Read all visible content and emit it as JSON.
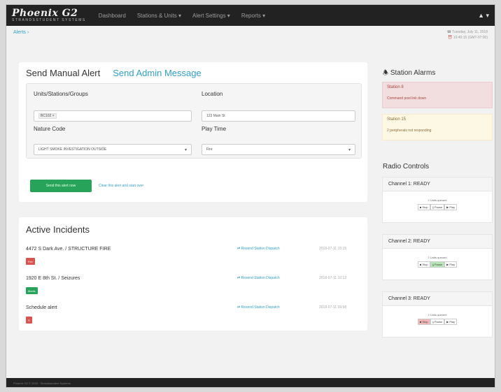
{
  "nav": {
    "logo": "Phoenix G2",
    "logo_sub": "STRANDSSTUDENT SYSTEMS",
    "items": [
      "Dashboard",
      "Stations & Units ▾",
      "Alert Settings ▾",
      "Reports ▾"
    ],
    "user": "▲ ▾"
  },
  "subheader": {
    "breadcrumb": "Alerts ›",
    "stamp_line1": "☎ Tuesday, July 11, 2018",
    "stamp_line2": "⏰ 10:40:15 (GMT-07:00)"
  },
  "alert": {
    "tab_active": "Send Manual Alert",
    "tab_link": "Send Admin Message",
    "units_label": "Units/Stations/Groups",
    "units_value": "BC102 ×",
    "location_label": "Location",
    "location_value": "123 Main St",
    "nature_label": "Nature Code",
    "nature_value": "LIGHT SMOKE INVESTIGATION OUTSIDE",
    "play_label": "Play Time",
    "play_value": "Fire",
    "send_label": "Send this alert now",
    "clear_label": "Clear this alert and start over"
  },
  "incidents": {
    "title": "Active Incidents",
    "link_label": "⇄ Resend Station Dispatch",
    "rows": [
      {
        "name": "4472 S Dark Ave. / STRUCTURE FIRE",
        "badge": "Fire",
        "badge_color": "#d9534f",
        "time": "2018-07-11 10:15"
      },
      {
        "name": "1920 E 8th St. / Seizures",
        "badge": "Medic",
        "badge_color": "#27a35a",
        "time": "2018-07-11 10:12"
      },
      {
        "name": "Schedule alert",
        "badge": "S",
        "badge_color": "#d9534f",
        "time": "2018-07-11 09:58"
      }
    ]
  },
  "alarms": {
    "title": "Station Alarms",
    "items": [
      {
        "name": "Station 8",
        "message": "Command post link down"
      },
      {
        "name": "Station 15",
        "message": "2 peripherals not responding"
      }
    ]
  },
  "radio": {
    "title": "Radio Controls",
    "status_text": "2 Units queued",
    "btn_stop": "■ Stop",
    "btn_pause": "|| Pause",
    "btn_play": "▶ Play",
    "channels": [
      {
        "name": "Channel 1: READY"
      },
      {
        "name": "Channel 2: READY"
      },
      {
        "name": "Channel 3: READY"
      }
    ]
  },
  "footer": {
    "text": "Phoenix G2 © 2018 · Strandsstudent Systems"
  }
}
